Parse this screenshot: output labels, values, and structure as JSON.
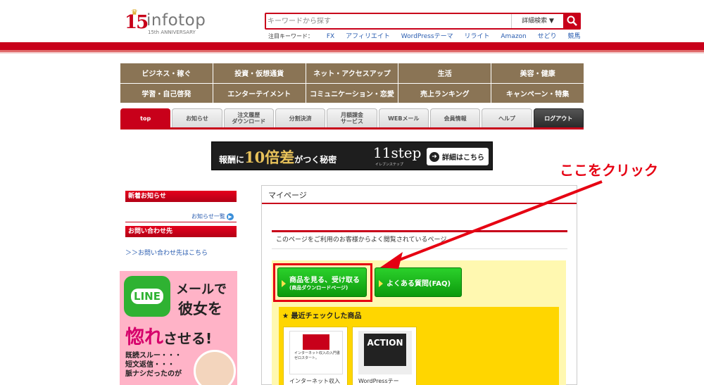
{
  "header": {
    "logo_number": "15",
    "logo_brand": "infotop",
    "logo_anniversary": "15th ANNIVERSARY",
    "search_placeholder": "キーワードから探す",
    "advanced_search_label": "詳細検索 ▼",
    "keywords_label": "注目キーワード：",
    "keywords": [
      "FX",
      "アフィリエイト",
      "WordPressテーマ",
      "リライト",
      "Amazon",
      "せどり",
      "競馬"
    ]
  },
  "categories": [
    "ビジネス・稼ぐ",
    "投資・仮想通貨",
    "ネット・アクセスアップ",
    "生活",
    "美容・健康",
    "学習・自己啓発",
    "エンターテイメント",
    "コミュニケーション・恋愛",
    "売上ランキング",
    "キャンペーン・特集"
  ],
  "tabs": [
    {
      "label": "top",
      "line2": ""
    },
    {
      "label": "お知らせ",
      "line2": ""
    },
    {
      "label": "注文履歴",
      "line2": "ダウンロード"
    },
    {
      "label": "分割決済",
      "line2": ""
    },
    {
      "label": "月額課金",
      "line2": "サービス"
    },
    {
      "label": "WEBメール",
      "line2": ""
    },
    {
      "label": "会員情報",
      "line2": ""
    },
    {
      "label": "ヘルプ",
      "line2": ""
    },
    {
      "label": "ログアウト",
      "line2": ""
    }
  ],
  "banner": {
    "text_pre": "報酬に",
    "text_big": "10倍差",
    "text_post": "がつく秘密",
    "brand": "11step",
    "brand_sub": "イレブンステップ",
    "button": "詳細はこちら"
  },
  "sidebar": {
    "news_header": "新着お知らせ",
    "news_link": "お知らせ一覧",
    "contact_header": "お問い合わせ先",
    "contact_link": "＞＞お問い合わせ先はこちら",
    "ad": {
      "logo": "LINE",
      "line1": "メールで",
      "line2": "彼女を",
      "line3a": "惚れ",
      "line3b": "させる!",
      "lines": "既読スルー・・・\n短文返信・・・\n脈ナシだったのが"
    }
  },
  "main": {
    "title": "マイページ",
    "description": "このページをご利用のお客様からよく閲覧されているページ",
    "download_button_line1": "商品を見る、受け取る",
    "download_button_line2": "(商品ダウンロードページ)",
    "faq_button": "よくある質問(FAQ)",
    "recent_header": "★ 最近チェックした商品",
    "products": [
      {
        "name": "インターネット収入",
        "thumb_text": "インターネット収入の入門書\nゼロスタート。"
      },
      {
        "name": "WordPressテー",
        "thumb_text": "ACTION"
      }
    ]
  },
  "annotation": {
    "text": "ここをクリック",
    "color": "#e60012"
  },
  "colors": {
    "brand_red": "#c8001a",
    "category_brown": "#8a7455",
    "button_green": "#1cb51c",
    "recent_yellow": "#ffd600"
  }
}
